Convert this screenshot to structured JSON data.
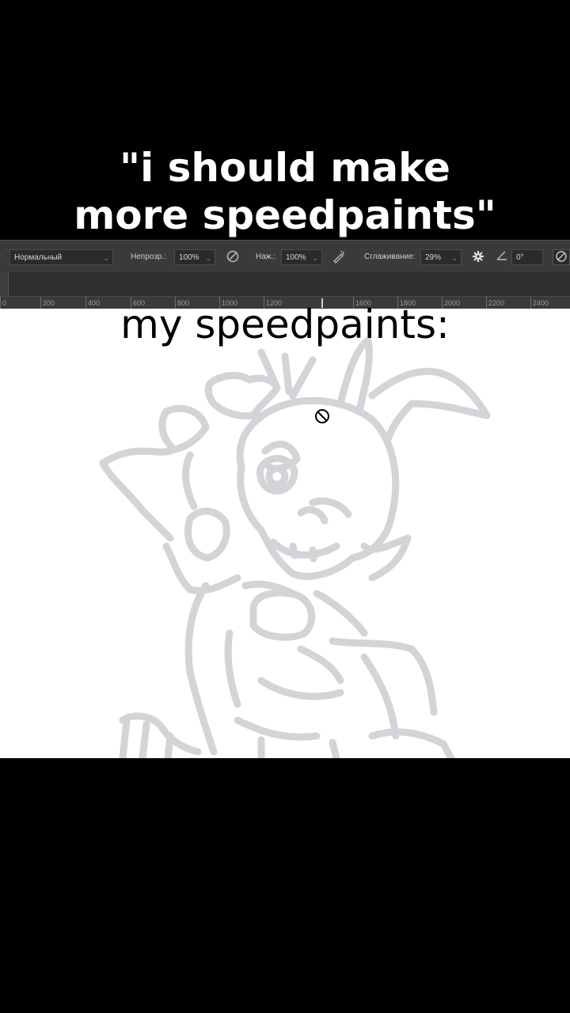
{
  "caption": {
    "line1": "\"i should make",
    "line2": "more speedpaints\""
  },
  "toolbar": {
    "blend_mode": "Нормальный",
    "opacity_label": "Непрозр.:",
    "opacity_value": "100%",
    "flow_label": "Наж.:",
    "flow_value": "100%",
    "smoothing_label": "Сглаживание:",
    "smoothing_value": "29%",
    "angle_value": "0°"
  },
  "ruler": {
    "labels": [
      "0",
      "200",
      "400",
      "600",
      "800",
      "1000",
      "1200",
      "1600",
      "1800",
      "2000",
      "2200",
      "2400"
    ]
  },
  "subcaption": "my speedpaints:",
  "colors": {
    "sketch_stroke": "#d2d4d8",
    "toolbar_bg": "#3a3a3a"
  }
}
